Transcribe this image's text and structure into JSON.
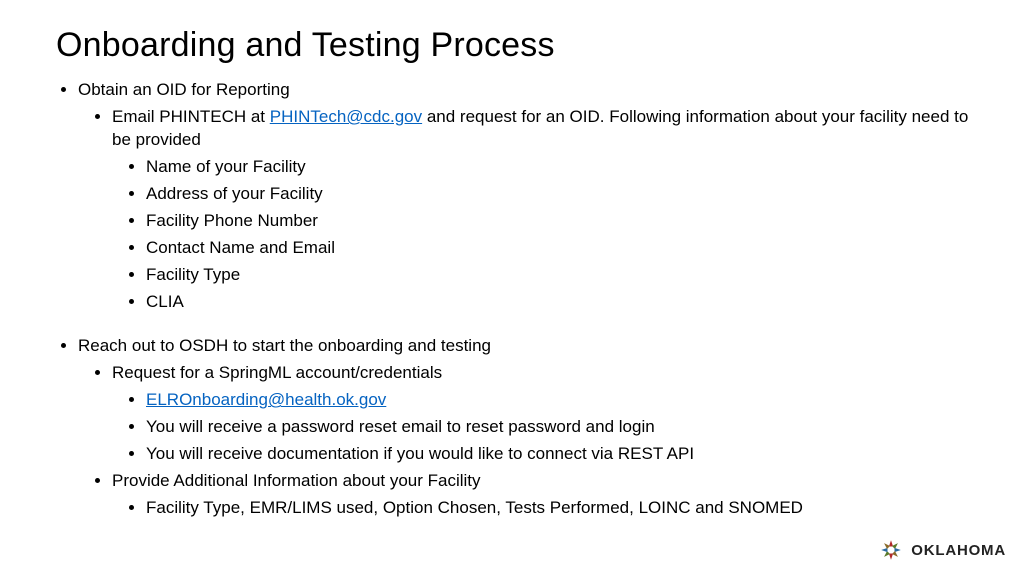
{
  "title": "Onboarding and Testing Process",
  "b1": {
    "text": "Obtain an OID for Reporting",
    "s1": {
      "pre": "Email PHINTECH at ",
      "link": "PHINTech@cdc.gov",
      "post": " and request for an OID. Following information about your facility need to be provided",
      "items": {
        "a": "Name of your Facility",
        "b": "Address of your Facility",
        "c": "Facility Phone Number",
        "d": "Contact Name and Email",
        "e": "Facility Type",
        "f": "CLIA"
      }
    }
  },
  "b2": {
    "text": "Reach out to OSDH to start the onboarding and testing",
    "s1": {
      "text": "Request for a SpringML account/credentials",
      "items": {
        "link": "ELROnboarding@health.ok.gov",
        "b": "You will receive a password reset email to reset password and login",
        "c": "You will receive documentation if you would like to connect via REST API"
      }
    },
    "s2": {
      "text": "Provide Additional Information about your Facility",
      "items": {
        "a": "Facility Type, EMR/LIMS used, Option Chosen, Tests Performed, LOINC and SNOMED"
      }
    }
  },
  "logo_text": "OKLAHOMA"
}
